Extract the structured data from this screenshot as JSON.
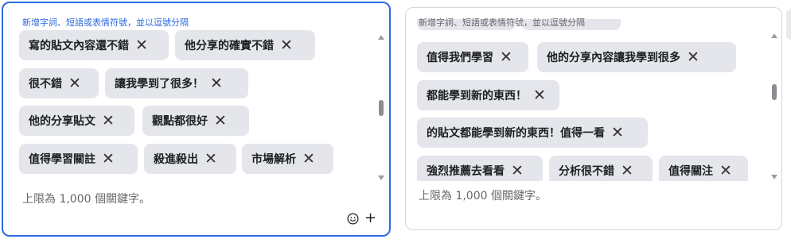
{
  "panels": [
    {
      "hint": "新增字詞、短語或表情符號，並以逗號分隔",
      "rows": [
        [
          "寫的貼文內容還不錯",
          "他分享的確實不錯"
        ],
        [
          "很不錯",
          "讓我學到了很多！"
        ],
        [
          "他的分享貼文",
          "觀點都很好"
        ],
        [
          "值得學習關註",
          "殺進殺出",
          "市場解析"
        ]
      ],
      "limit": "上限為 1,000 個關鍵字。"
    },
    {
      "hint": "新增字詞、短語或表情符號，並以逗號分隔",
      "rows": [
        [
          "值得我們學習",
          "他的分享內容讓我學到很多"
        ],
        [
          "都能學到新的東西！"
        ],
        [
          "的貼文都能學到新的東西！值得一看"
        ],
        [
          "強烈推薦去看看",
          "分析很不錯",
          "值得關注"
        ]
      ],
      "limit": "上限為 1,000 個關鍵字。"
    }
  ],
  "remove_glyph": "✕",
  "add_glyph": "+",
  "colors": {
    "focus": "#2c6ae0",
    "chip": "#e4e6eb",
    "muted": "#65676b"
  }
}
